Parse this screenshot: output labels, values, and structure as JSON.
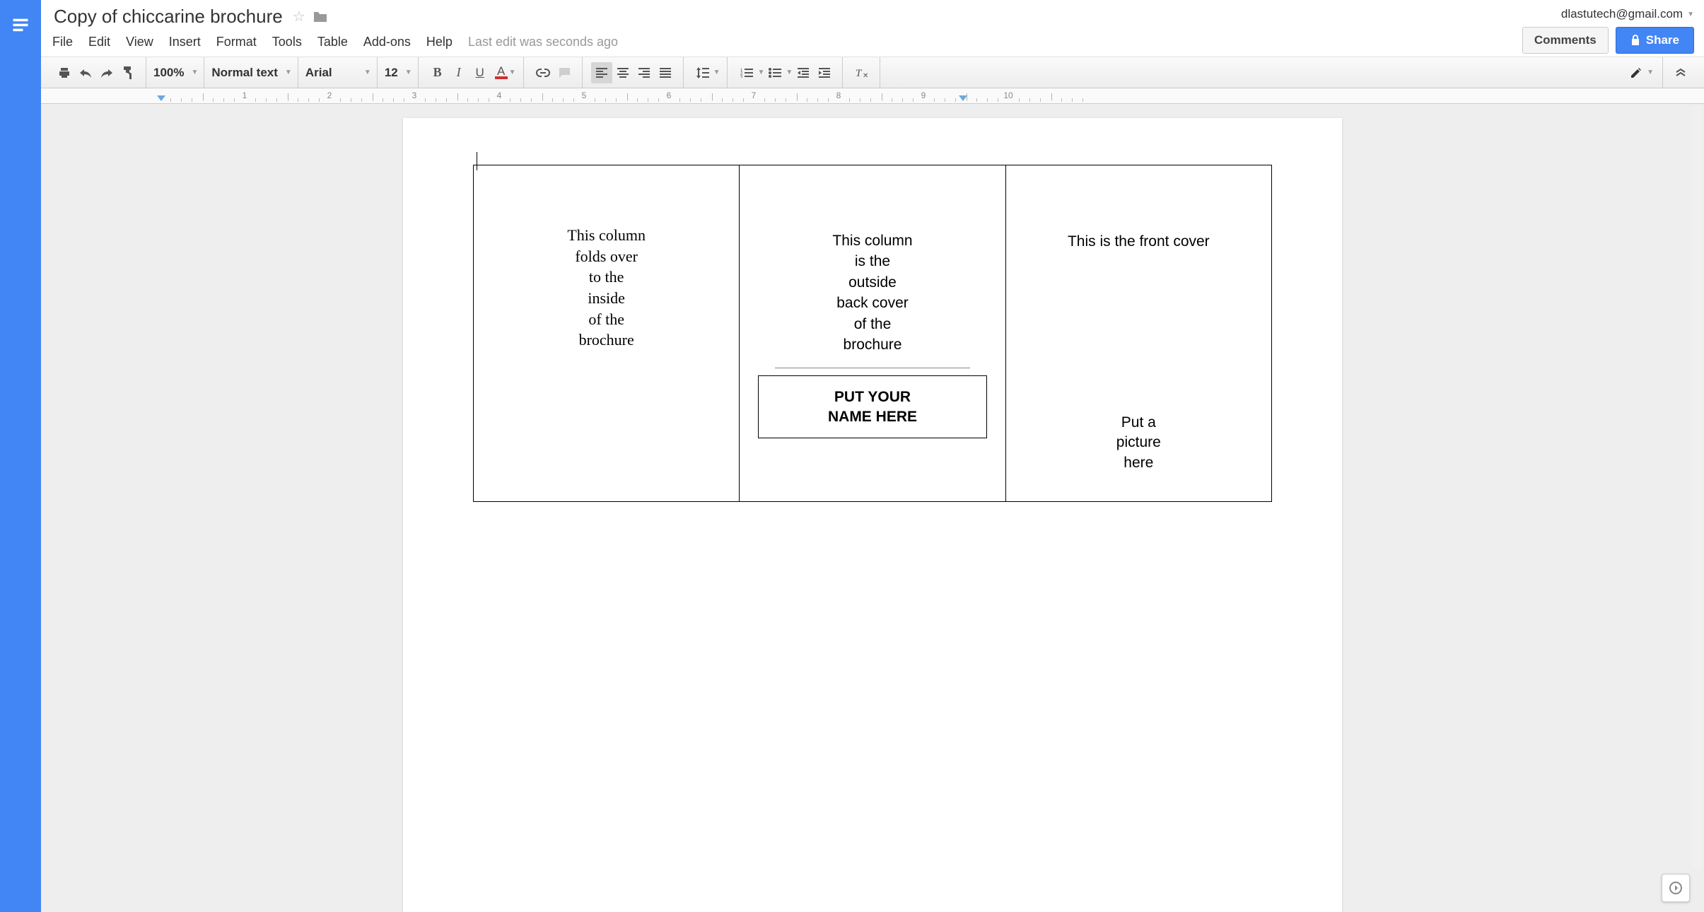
{
  "header": {
    "doc_title": "Copy of chiccarine brochure",
    "user_email": "dlastutech@gmail.com",
    "comments_btn": "Comments",
    "share_btn": "Share"
  },
  "menu": {
    "items": [
      "File",
      "Edit",
      "View",
      "Insert",
      "Format",
      "Tools",
      "Table",
      "Add-ons",
      "Help"
    ],
    "last_edit": "Last edit was seconds ago"
  },
  "toolbar": {
    "zoom": "100%",
    "style": "Normal text",
    "font": "Arial",
    "size": "12"
  },
  "ruler": {
    "marks": [
      1,
      2,
      3,
      4,
      5,
      6,
      7,
      8,
      9,
      10
    ]
  },
  "document": {
    "col1": "This column\nfolds over\nto the\ninside\nof the\nbrochure",
    "col2_text": "This column\nis the\noutside\nback cover\nof the\nbrochure",
    "col2_name_box": "PUT YOUR\nNAME HERE",
    "col3_title": "This is the front cover",
    "col3_pic": "Put a\npicture\nhere"
  }
}
